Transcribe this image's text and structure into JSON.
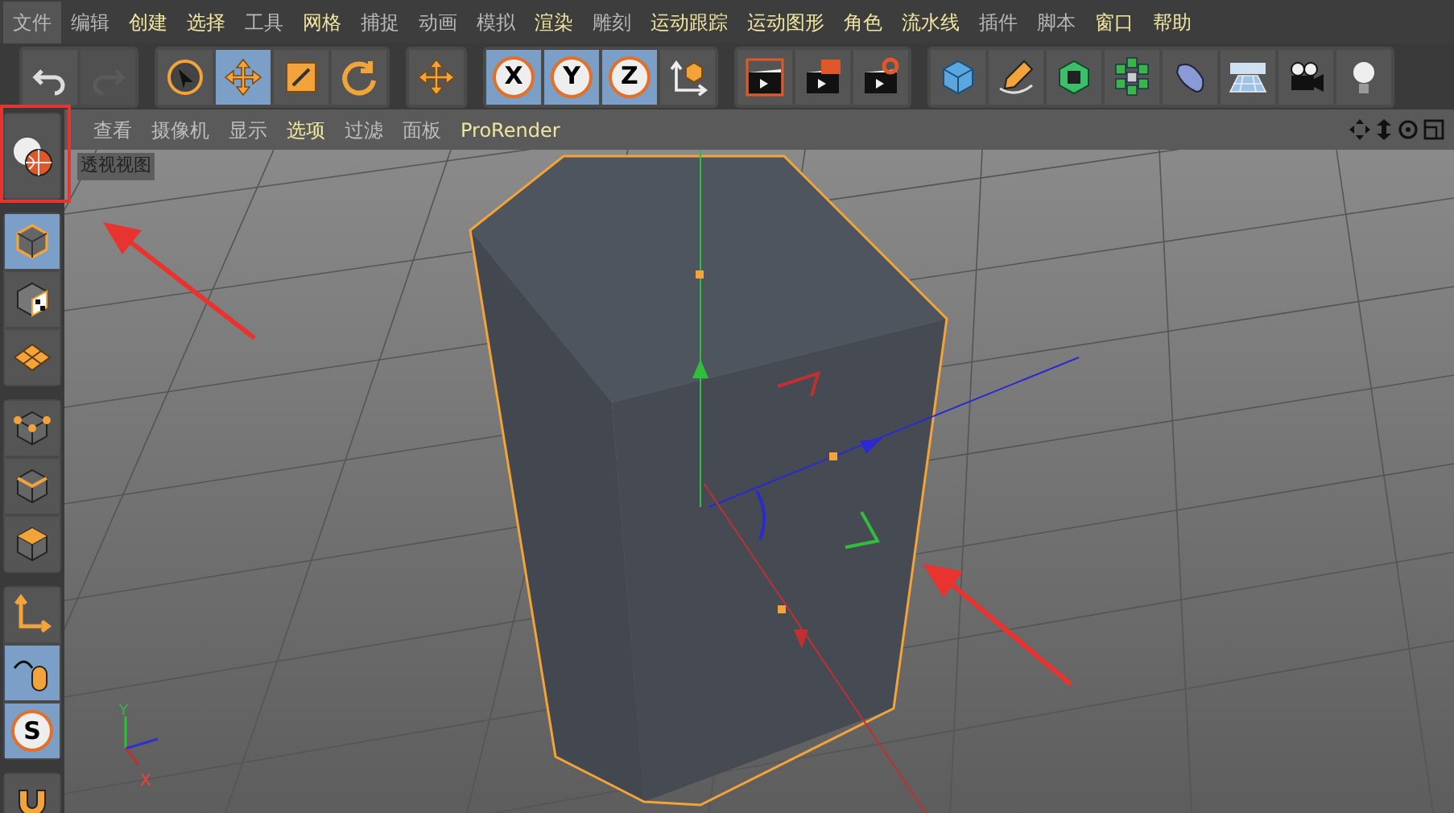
{
  "menu": [
    {
      "label": "文件",
      "accent": false,
      "selected": true
    },
    {
      "label": "编辑",
      "accent": false,
      "selected": false
    },
    {
      "label": "创建",
      "accent": true,
      "selected": false
    },
    {
      "label": "选择",
      "accent": true,
      "selected": false
    },
    {
      "label": "工具",
      "accent": false,
      "selected": false
    },
    {
      "label": "网格",
      "accent": true,
      "selected": false
    },
    {
      "label": "捕捉",
      "accent": false,
      "selected": false
    },
    {
      "label": "动画",
      "accent": false,
      "selected": false
    },
    {
      "label": "模拟",
      "accent": false,
      "selected": false
    },
    {
      "label": "渲染",
      "accent": true,
      "selected": false
    },
    {
      "label": "雕刻",
      "accent": false,
      "selected": false
    },
    {
      "label": "运动跟踪",
      "accent": true,
      "selected": false
    },
    {
      "label": "运动图形",
      "accent": true,
      "selected": false
    },
    {
      "label": "角色",
      "accent": true,
      "selected": false
    },
    {
      "label": "流水线",
      "accent": true,
      "selected": false
    },
    {
      "label": "插件",
      "accent": false,
      "selected": false
    },
    {
      "label": "脚本",
      "accent": false,
      "selected": false
    },
    {
      "label": "窗口",
      "accent": true,
      "selected": false
    },
    {
      "label": "帮助",
      "accent": true,
      "selected": false
    }
  ],
  "toolbar": [
    [
      {
        "kind": "undo",
        "selected": false,
        "disabled": false
      },
      {
        "kind": "redo",
        "selected": false,
        "disabled": true
      }
    ],
    [
      {
        "kind": "select",
        "selected": false,
        "disabled": false
      },
      {
        "kind": "move",
        "selected": true,
        "disabled": false
      },
      {
        "kind": "scale",
        "selected": false,
        "disabled": false
      },
      {
        "kind": "rotate",
        "selected": false,
        "disabled": false
      }
    ],
    [
      {
        "kind": "move",
        "selected": false,
        "disabled": false
      }
    ],
    [
      {
        "kind": "axis",
        "label": "X",
        "selected": true,
        "disabled": false
      },
      {
        "kind": "axis",
        "label": "Y",
        "selected": true,
        "disabled": false
      },
      {
        "kind": "axis",
        "label": "Z",
        "selected": true,
        "disabled": false
      },
      {
        "kind": "coords",
        "selected": false,
        "disabled": false
      }
    ],
    [
      {
        "kind": "render-region",
        "selected": false,
        "disabled": false
      },
      {
        "kind": "render-view",
        "selected": false,
        "disabled": false
      },
      {
        "kind": "render-settings",
        "selected": false,
        "disabled": false
      }
    ],
    [
      {
        "kind": "cube",
        "selected": false,
        "disabled": false
      },
      {
        "kind": "pen",
        "selected": false,
        "disabled": false
      },
      {
        "kind": "subdivision",
        "selected": false,
        "disabled": false
      },
      {
        "kind": "cloner",
        "selected": false,
        "disabled": false
      },
      {
        "kind": "deformer",
        "selected": false,
        "disabled": false
      },
      {
        "kind": "floor",
        "selected": false,
        "disabled": false
      },
      {
        "kind": "camera",
        "selected": false,
        "disabled": false
      },
      {
        "kind": "light",
        "selected": false,
        "disabled": false
      }
    ]
  ],
  "viewport_menu": [
    {
      "label": "查看",
      "accent": false
    },
    {
      "label": "摄像机",
      "accent": false
    },
    {
      "label": "显示",
      "accent": false
    },
    {
      "label": "选项",
      "accent": true
    },
    {
      "label": "过滤",
      "accent": false
    },
    {
      "label": "面板",
      "accent": false
    },
    {
      "label": "ProRender",
      "accent": true
    }
  ],
  "viewport_label": "透视视图",
  "side_tools": [
    [
      {
        "kind": "globe",
        "selected": false
      }
    ],
    [
      {
        "kind": "model",
        "selected": true
      },
      {
        "kind": "texture",
        "selected": false
      },
      {
        "kind": "workplane",
        "selected": false
      }
    ],
    [
      {
        "kind": "points",
        "selected": false
      },
      {
        "kind": "edges",
        "selected": false
      },
      {
        "kind": "polygons",
        "selected": false
      }
    ],
    [
      {
        "kind": "axis",
        "selected": false
      },
      {
        "kind": "tweak",
        "selected": true
      },
      {
        "kind": "snap",
        "label": "S",
        "selected": true
      }
    ],
    [
      {
        "kind": "magnet",
        "selected": false
      }
    ]
  ],
  "axis_labels": {
    "y": "Y",
    "x": "X"
  }
}
